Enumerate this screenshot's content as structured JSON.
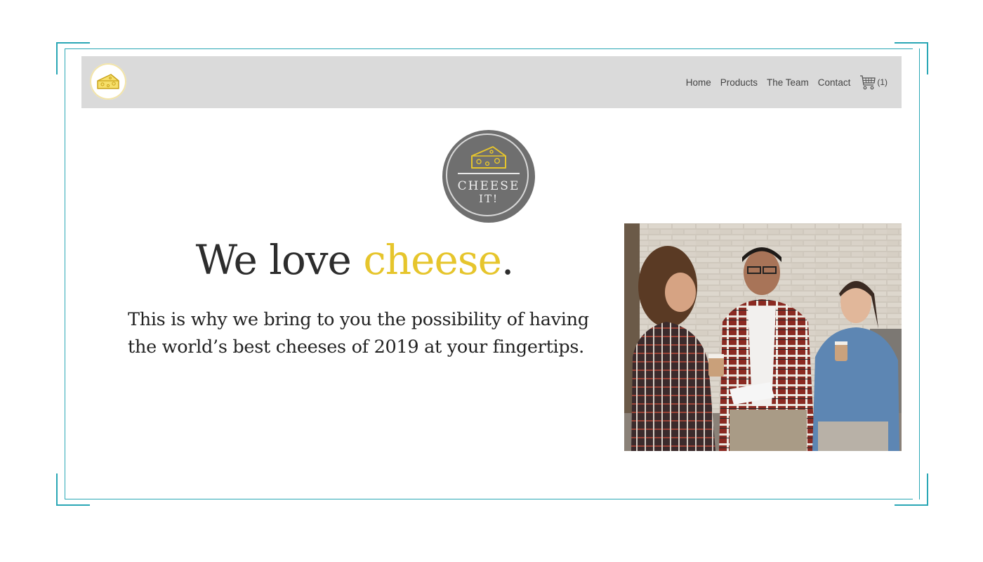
{
  "nav": {
    "links": [
      "Home",
      "Products",
      "The Team",
      "Contact"
    ],
    "cart_count": "(1)",
    "logo_icon": "cheese-icon",
    "cart_icon": "cart-icon"
  },
  "brand": {
    "logo_line1": "CHEESE",
    "logo_line2": "IT!"
  },
  "hero": {
    "headline_part1": "We love ",
    "headline_accent": "cheese",
    "headline_end": ".",
    "tagline": "This is why we bring to you the possibility of having the world’s best cheeses of 2019 at your fingertips."
  },
  "colors": {
    "accent": "#e6c52c",
    "frame": "#2aa7b5",
    "navbar": "#dadada",
    "logo_bg": "#6f6f6f"
  }
}
